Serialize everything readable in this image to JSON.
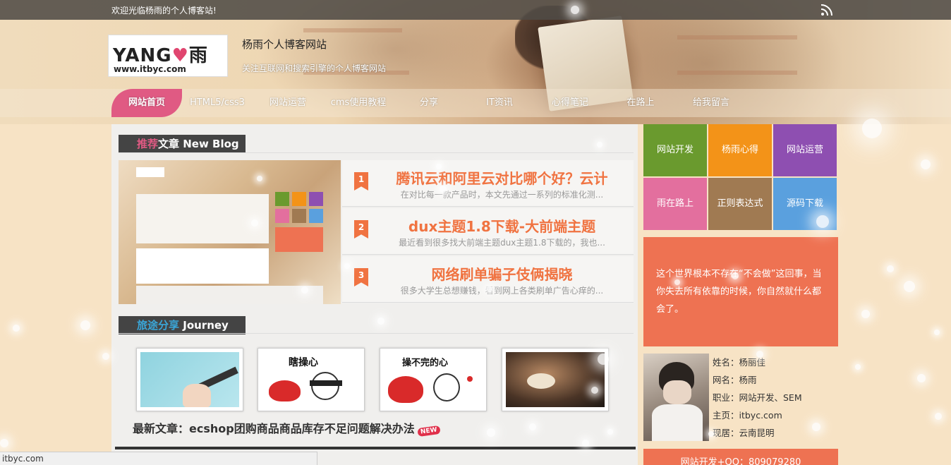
{
  "topbar": {
    "welcome": "欢迎光临杨雨的个人博客站!",
    "rss_icon": "rss-icon"
  },
  "brand": {
    "logo_main_left": "YANG",
    "logo_main_right": "雨",
    "logo_url": "www.itbyc.com",
    "site_title": "杨雨个人博客网站",
    "site_subtitle": "关注互联网和搜索引擎的个人博客网站"
  },
  "nav": {
    "items": [
      {
        "label": "网站首页",
        "active": true
      },
      {
        "label": "HTML5/css3"
      },
      {
        "label": "网站运营"
      },
      {
        "label": "cms使用教程"
      },
      {
        "label": "分享"
      },
      {
        "label": "IT资讯"
      },
      {
        "label": "心得笔记"
      },
      {
        "label": "在路上"
      },
      {
        "label": "给我留言"
      }
    ]
  },
  "recommended": {
    "heading_highlight": "推荐",
    "heading_rest": "文章 New Blog",
    "posts": [
      {
        "rank": "1",
        "title": "腾讯云和阿里云对比哪个好？云计",
        "excerpt": "在对比每一款产品时，本文先通过一系列的标准化测..."
      },
      {
        "rank": "2",
        "title": "dux主题1.8下载-大前端主题",
        "excerpt": "最近看到很多找大前端主题dux主题1.8下载的，我也..."
      },
      {
        "rank": "3",
        "title": "网络刷单骗子伎俩揭晓",
        "excerpt": "很多大学生总想赚钱，看到网上各类刷单广告心痒的..."
      }
    ]
  },
  "journey": {
    "heading_highlight": "旅途分享",
    "heading_rest": " Journey",
    "thumbs": [
      {
        "caption": ""
      },
      {
        "caption": "瞎操心"
      },
      {
        "caption": "操不完的心"
      },
      {
        "caption": ""
      }
    ],
    "latest_label": "最新文章：ecshop团购商品商品库存不足问题解决办法",
    "new_badge": "NEW"
  },
  "tiles": [
    {
      "label": "网站开发",
      "color": "#6a9a2e"
    },
    {
      "label": "杨雨心得",
      "color": "#f39318"
    },
    {
      "label": "网站运营",
      "color": "#8e4fb1"
    },
    {
      "label": "雨在路上",
      "color": "#e36f9e"
    },
    {
      "label": "正则表达式",
      "color": "#a07a52"
    },
    {
      "label": "源码下载",
      "color": "#5aa0de"
    }
  ],
  "quote": "这个世界根本不存在“不会做”这回事，当你失去所有依靠的时候，你自然就什么都会了。",
  "profile": {
    "rows": [
      "姓名：杨丽佳",
      "网名：杨雨",
      "职业：网站开发、SEM",
      "主页：itbyc.com",
      "现居：云南昆明"
    ]
  },
  "contact": "网站开发+QQ：809079280",
  "statusbar": "itbyc.com",
  "colors": {
    "accent_pink": "#e05a83",
    "accent_orange": "#f07341",
    "quote_bg": "#ee7252"
  }
}
